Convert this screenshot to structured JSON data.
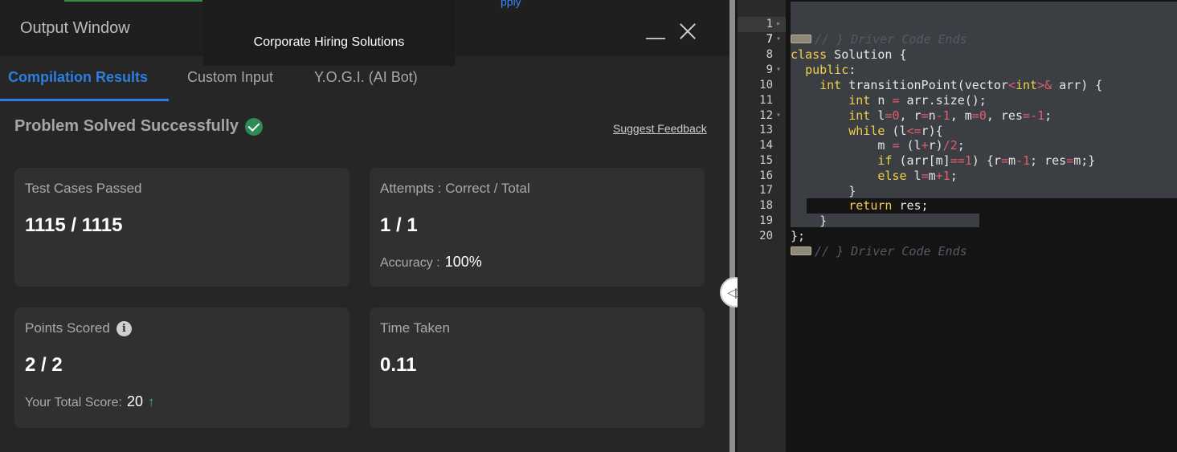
{
  "output_window": {
    "title": "Output Window",
    "overlay_top_text": "pply",
    "overlay_text": "Corporate Hiring Solutions"
  },
  "tabs": [
    {
      "label": "Compilation Results",
      "active": true
    },
    {
      "label": "Custom Input",
      "active": false
    },
    {
      "label": "Y.O.G.I. (AI Bot)",
      "active": false
    }
  ],
  "result": {
    "status": "Problem Solved Successfully",
    "feedback_link": "Suggest Feedback"
  },
  "cards": {
    "test_cases": {
      "label": "Test Cases Passed",
      "value": "1115 / 1115"
    },
    "attempts": {
      "label": "Attempts : Correct / Total",
      "value": "1 / 1",
      "sub_label": "Accuracy :",
      "sub_value": "100%"
    },
    "points": {
      "label": "Points Scored",
      "value": "2 / 2",
      "sub_label": "Your Total Score:",
      "sub_value": "20"
    },
    "time": {
      "label": "Time Taken",
      "value": "0.11"
    }
  },
  "editor": {
    "active_line": 7,
    "line_numbers": [
      "1",
      "7",
      "8",
      "9",
      "10",
      "11",
      "12",
      "13",
      "14",
      "15",
      "16",
      "17",
      "18",
      "19",
      "20"
    ],
    "folded_comment": "// } Driver Code Ends"
  },
  "colors": {
    "accent_blue": "#2e7de0",
    "success_green": "#2e8b57",
    "keyword_yellow": "#f2cf4a",
    "number_red": "#e35d6a"
  }
}
